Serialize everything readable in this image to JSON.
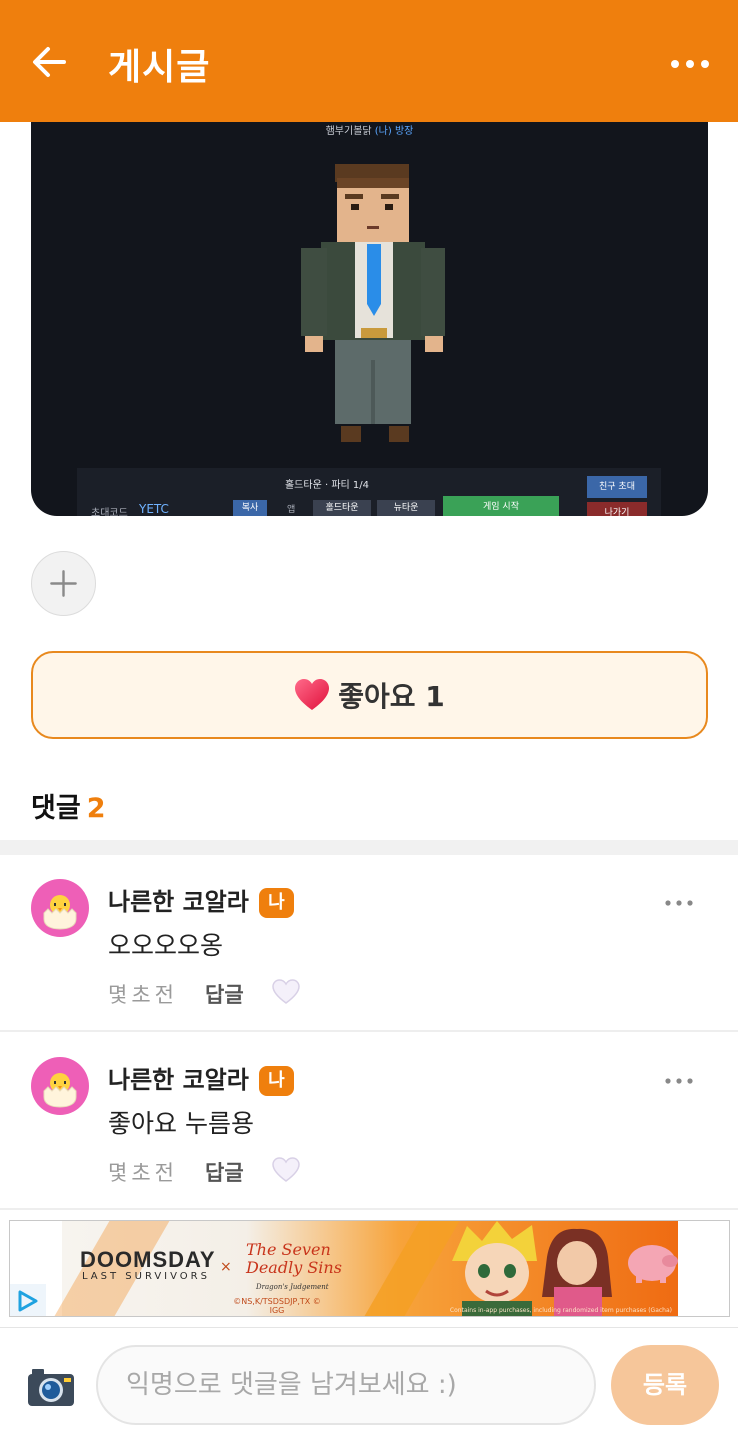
{
  "header": {
    "title": "게시글",
    "back_icon": "arrow-left-icon",
    "more_icon": "more-horizontal-icon",
    "color": "#ef7f0d"
  },
  "post_image": {
    "room_title": "햄부기볼닭",
    "room_tag": "(나)",
    "room_suffix": "방장",
    "lobby_status": "홀드타운 · 파티 1/4",
    "invite_label": "초대코드",
    "invite_code": "YETC",
    "copy_button": "복사",
    "app_label": "앱",
    "holdtown_button": "홀드타운",
    "newtown_button": "뉴타운",
    "start_button": "게임 시작",
    "friend_invite_button": "친구 초대",
    "leave_button": "나가기"
  },
  "actions": {
    "add_icon": "plus-icon",
    "like_label": "좋아요 1",
    "like_icon": "heart-icon"
  },
  "comments_section": {
    "heading": "댓글",
    "count": "2"
  },
  "comments": [
    {
      "author": "나른한 코알라",
      "badge": "나",
      "text": "오오오오옹",
      "time": "몇초전",
      "reply_label": "답글",
      "avatar_icon": "hatching-chick-icon"
    },
    {
      "author": "나른한 코알라",
      "badge": "나",
      "text": "좋아요 누름용",
      "time": "몇초전",
      "reply_label": "답글",
      "avatar_icon": "hatching-chick-icon"
    }
  ],
  "ad": {
    "title_1": "DOOMSDAY",
    "title_1b": "LAST SURVIVORS",
    "cross": "×",
    "title_2": "The Seven Deadly Sins",
    "title_2b": "Dragon's Judgement",
    "copyright": "©NS,K/TSDSDJP,TX © IGG",
    "fineprint": "Contains in-app purchases, including randomized item purchases (Gacha)",
    "ad_icon": "ad-choices-icon"
  },
  "input_bar": {
    "camera_icon": "camera-icon",
    "placeholder": "익명으로 댓글을 남겨보세요 :)",
    "submit_label": "등록"
  }
}
